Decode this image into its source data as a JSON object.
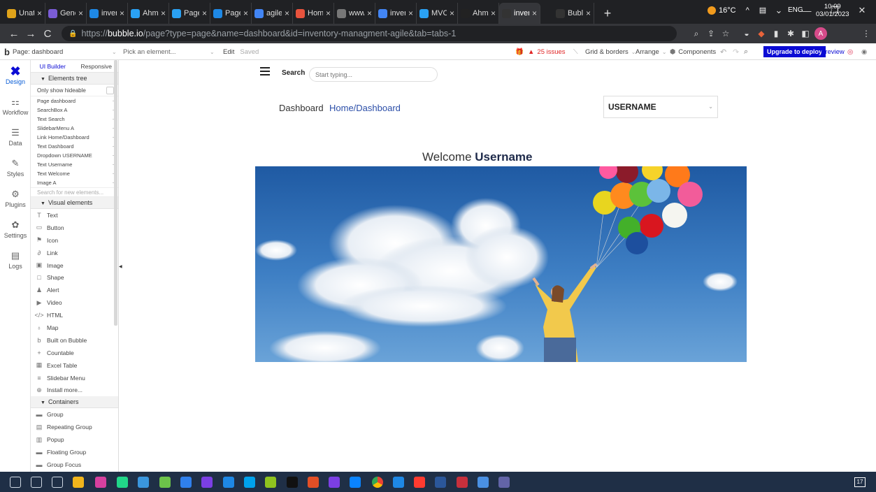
{
  "browser": {
    "tabs": [
      {
        "label": "Unat",
        "icon": "unat-icon",
        "color": "#e0a31a"
      },
      {
        "label": "Gene",
        "icon": "gene-icon",
        "color": "#7a5cd6"
      },
      {
        "label": "inver",
        "icon": "bubble-blue-icon",
        "color": "#1e88e5"
      },
      {
        "label": "Ahm",
        "icon": "ahm-icon",
        "color": "#2aa1f3"
      },
      {
        "label": "Page",
        "icon": "page-icon",
        "color": "#2aa1f3"
      },
      {
        "label": "Page",
        "icon": "page-icon",
        "color": "#1e88e5"
      },
      {
        "label": "agile",
        "icon": "google-icon",
        "color": "#4285f4"
      },
      {
        "label": "Hom",
        "icon": "home-icon",
        "color": "#e8533d"
      },
      {
        "label": "www",
        "icon": "globe-icon",
        "color": "#777777"
      },
      {
        "label": "inver",
        "icon": "google-icon",
        "color": "#4285f4"
      },
      {
        "label": "MVC",
        "icon": "mvc-icon",
        "color": "#2aa1f3"
      },
      {
        "label": "Ahm",
        "icon": "github-icon",
        "color": "#222222"
      },
      {
        "label": "inver",
        "icon": "bubble-icon",
        "color": "#333333"
      },
      {
        "label": "Bubl",
        "icon": "bubble-icon",
        "color": "#333333"
      }
    ],
    "active_tab": 12,
    "new_tab": "+",
    "url_prefix": "https://",
    "url_host": "bubble.io",
    "url_path": "/page?type=page&name=dashboard&id=inventory-managment-agile&tab=tabs-1",
    "profile_initial": "A"
  },
  "editor": {
    "page_label": "Page: dashboard",
    "pick_element": "Pick an element...",
    "edit": "Edit",
    "saved": "Saved",
    "issues": "25 issues",
    "grid": "Grid & borders",
    "arrange": "Arrange",
    "components": "Components",
    "upgrade": "Upgrade to deploy",
    "preview": "Preview"
  },
  "rail": [
    {
      "label": "Design",
      "icon": "design-icon",
      "active": true
    },
    {
      "label": "Workflow",
      "icon": "workflow-icon"
    },
    {
      "label": "Data",
      "icon": "database-icon"
    },
    {
      "label": "Styles",
      "icon": "brush-icon"
    },
    {
      "label": "Plugins",
      "icon": "plugin-icon"
    },
    {
      "label": "Settings",
      "icon": "gear-icon"
    },
    {
      "label": "Logs",
      "icon": "document-icon"
    }
  ],
  "panel": {
    "tab_ui": "UI Builder",
    "tab_responsive": "Responsive",
    "tree_header": "Elements tree",
    "only_hideable": "Only show hideable",
    "tree": [
      "Page dashboard",
      "SearchBox A",
      "Text Search",
      "SlidebarMenu A",
      "Link Home/Dashboard",
      "Text Dashboard",
      "Dropdown USERNAME",
      "Text Username",
      "Text Welcome",
      "Image A"
    ],
    "search_placeholder": "Search for new elements...",
    "visual_header": "Visual elements",
    "visual": [
      {
        "label": "Text",
        "icon": "text-icon",
        "glyph": "T"
      },
      {
        "label": "Button",
        "icon": "button-icon",
        "glyph": "▭"
      },
      {
        "label": "Icon",
        "icon": "icon-icon",
        "glyph": "⚑"
      },
      {
        "label": "Link",
        "icon": "link-icon",
        "glyph": "∂"
      },
      {
        "label": "Image",
        "icon": "image-icon",
        "glyph": "▣"
      },
      {
        "label": "Shape",
        "icon": "shape-icon",
        "glyph": "□"
      },
      {
        "label": "Alert",
        "icon": "alert-icon",
        "glyph": "♟"
      },
      {
        "label": "Video",
        "icon": "video-icon",
        "glyph": "▶"
      },
      {
        "label": "HTML",
        "icon": "html-icon",
        "glyph": "</>"
      },
      {
        "label": "Map",
        "icon": "map-pin-icon",
        "glyph": "♁"
      },
      {
        "label": "Built on Bubble",
        "icon": "bubble-logo-icon",
        "glyph": "b"
      },
      {
        "label": "Countable",
        "icon": "plus-icon",
        "glyph": "+"
      },
      {
        "label": "Excel Table",
        "icon": "table-icon",
        "glyph": "▦"
      },
      {
        "label": "Slidebar Menu",
        "icon": "menu-icon",
        "glyph": "≡"
      },
      {
        "label": "Install more...",
        "icon": "plus-circle-icon",
        "glyph": "⊕"
      }
    ],
    "containers_header": "Containers",
    "containers": [
      {
        "label": "Group",
        "icon": "folder-icon",
        "glyph": "▬"
      },
      {
        "label": "Repeating Group",
        "icon": "repeating-group-icon",
        "glyph": "▤"
      },
      {
        "label": "Popup",
        "icon": "popup-icon",
        "glyph": "▥"
      },
      {
        "label": "Floating Group",
        "icon": "floating-group-icon",
        "glyph": "▬"
      },
      {
        "label": "Group Focus",
        "icon": "group-focus-icon",
        "glyph": "▬"
      }
    ]
  },
  "canvas": {
    "search_label": "Search",
    "search_placeholder": "Start typing...",
    "crumb_dashboard": "Dashboard",
    "crumb_link": "Home/Dashboard",
    "username_dropdown": "USERNAME",
    "welcome_prefix": "Welcome",
    "welcome_name": "Username"
  },
  "taskbar": {
    "temperature": "16°C",
    "language": "ENG",
    "time": "10:09",
    "date": "03/01/2023",
    "notifications": "17"
  }
}
